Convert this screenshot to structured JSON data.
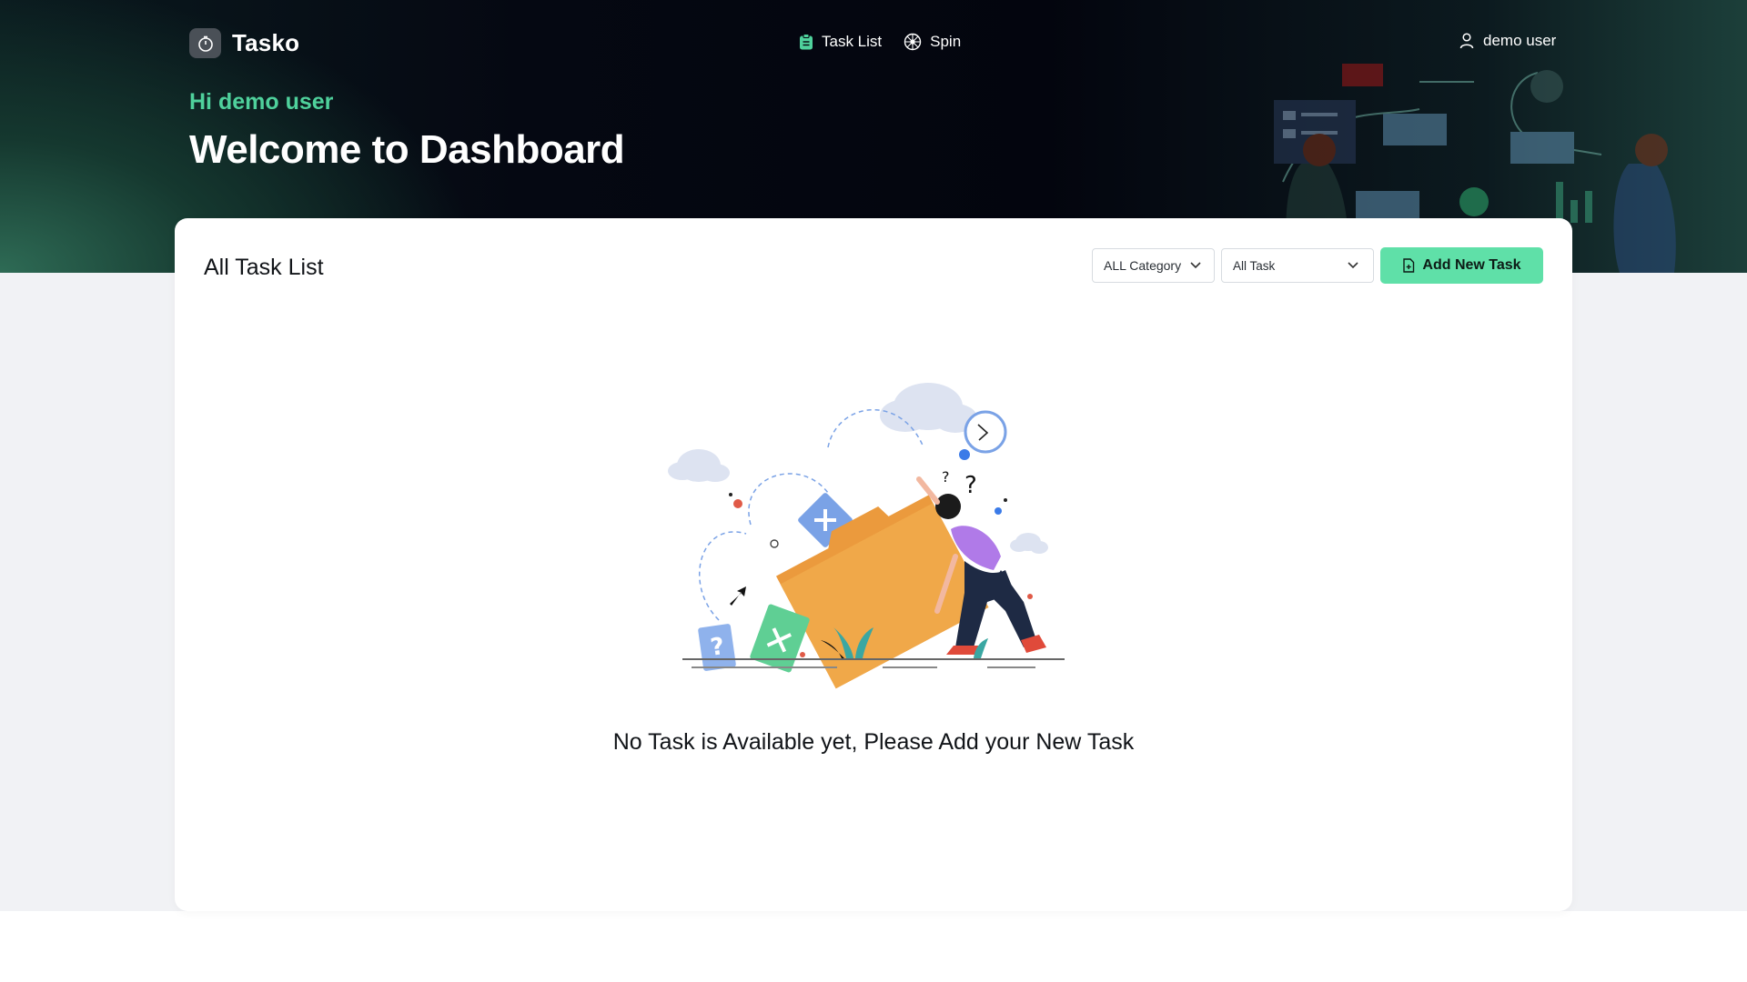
{
  "app": {
    "name": "Tasko"
  },
  "nav": {
    "items": [
      {
        "label": "Task List",
        "icon": "clipboard-icon"
      },
      {
        "label": "Spin",
        "icon": "spin-wheel-icon"
      }
    ]
  },
  "user": {
    "name": "demo user",
    "icon": "user-icon"
  },
  "hero": {
    "greeting": "Hi demo user",
    "title": "Welcome to Dashboard"
  },
  "card": {
    "title": "All Task List",
    "filters": {
      "category": "ALL Category",
      "task": "All Task"
    },
    "add_button": "Add New Task",
    "empty_message": "No Task is Available yet, Please Add your New Task"
  },
  "colors": {
    "accent": "#5fe0a8",
    "greeting": "#4fd19c",
    "hero_bg": "#03050e",
    "page_bg": "#f1f2f5"
  }
}
